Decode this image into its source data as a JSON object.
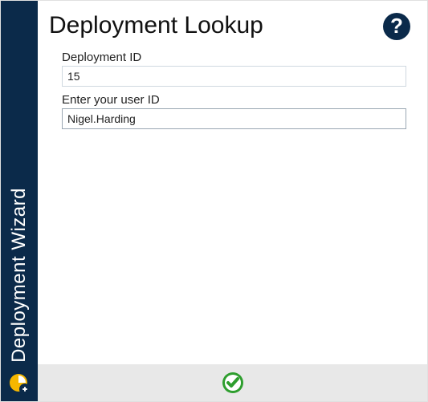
{
  "sidebar": {
    "title": "Deployment Wizard"
  },
  "page": {
    "title": "Deployment Lookup"
  },
  "form": {
    "deployment_id": {
      "label": "Deployment ID",
      "value": "15"
    },
    "user_id": {
      "label": "Enter your user ID",
      "value": "Nigel.Harding"
    }
  },
  "icons": {
    "help": "help-icon",
    "confirm": "check-circle-icon",
    "sidebar_logo": "deployment-wizard-icon"
  }
}
